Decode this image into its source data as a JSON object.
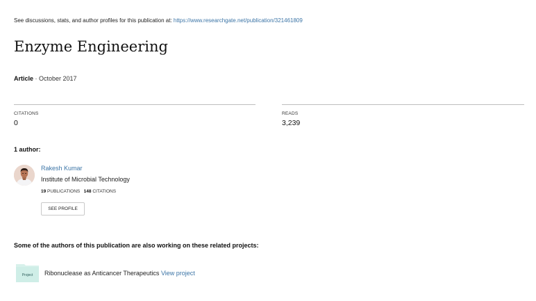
{
  "header": {
    "notice_prefix": "See discussions, stats, and author profiles for this publication at: ",
    "notice_url": "https://www.researchgate.net/publication/321461809"
  },
  "publication": {
    "title": "Enzyme Engineering",
    "type": "Article",
    "date": "· October 2017"
  },
  "stats": {
    "citations_label": "CITATIONS",
    "citations_value": "0",
    "reads_label": "READS",
    "reads_value": "3,239"
  },
  "authors": {
    "heading": "1 author:",
    "list": [
      {
        "name": "Rakesh Kumar",
        "institution": "Institute of Microbial Technology",
        "publications_count": "19",
        "publications_label": "PUBLICATIONS",
        "citations_count": "148",
        "citations_label": "CITATIONS",
        "button_label": "SEE PROFILE"
      }
    ]
  },
  "related": {
    "heading": "Some of the authors of this publication are also working on these related projects:",
    "projects": [
      {
        "icon_label": "Project",
        "title": "Ribonuclease as Anticancer Therapeutics",
        "link_label": "View project"
      }
    ]
  },
  "colors": {
    "link": "#3b74a6",
    "project_icon": "#cfeee7",
    "divider": "#bdbdbd"
  }
}
